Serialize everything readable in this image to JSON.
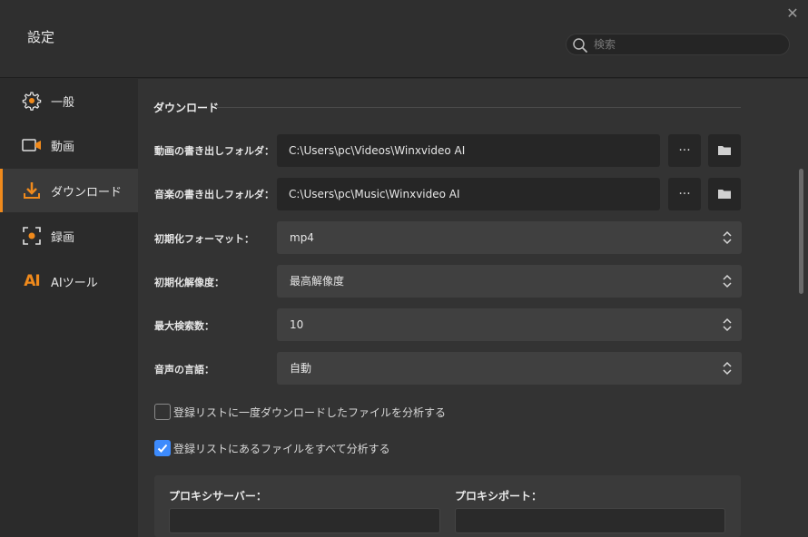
{
  "window": {
    "title": "設定",
    "close_glyph": "✕"
  },
  "search": {
    "placeholder": "検索"
  },
  "sidebar": {
    "items": [
      {
        "label": "一般",
        "icon": "gear-icon"
      },
      {
        "label": "動画",
        "icon": "video-camera-icon"
      },
      {
        "label": "ダウンロード",
        "icon": "download-icon",
        "active": true
      },
      {
        "label": "録画",
        "icon": "record-icon"
      },
      {
        "label": "AIツール",
        "icon": "ai-tools-icon",
        "glyph": "AI"
      }
    ]
  },
  "download": {
    "section_title": "ダウンロード",
    "video_folder_label": "動画の書き出しフォルダ：",
    "video_folder_value": "C:\\Users\\pc\\Videos\\Winxvideo AI",
    "audio_folder_label": "音楽の書き出しフォルダ：",
    "audio_folder_value": "C:\\Users\\pc\\Music\\Winxvideo AI",
    "more_glyph": "···",
    "format_label": "初期化フォーマット：",
    "format_value": "mp4",
    "resolution_label": "初期化解像度：",
    "resolution_value": "最高解像度",
    "max_search_label": "最大検索数：",
    "max_search_value": "10",
    "audio_lang_label": "音声の言語：",
    "audio_lang_value": "自動",
    "check_analyze_downloaded": "登録リストに一度ダウンロードしたファイルを分析する",
    "check_analyze_downloaded_state": false,
    "check_analyze_all": "登録リストにあるファイルをすべて分析する",
    "check_analyze_all_state": true,
    "proxy_server_label": "プロキシサーバー：",
    "proxy_port_label": "プロキシポート：",
    "proxy_server_value": "",
    "proxy_port_value": ""
  },
  "colors": {
    "accent": "#f08a1c",
    "checkbox_checked": "#3d8bfd"
  }
}
